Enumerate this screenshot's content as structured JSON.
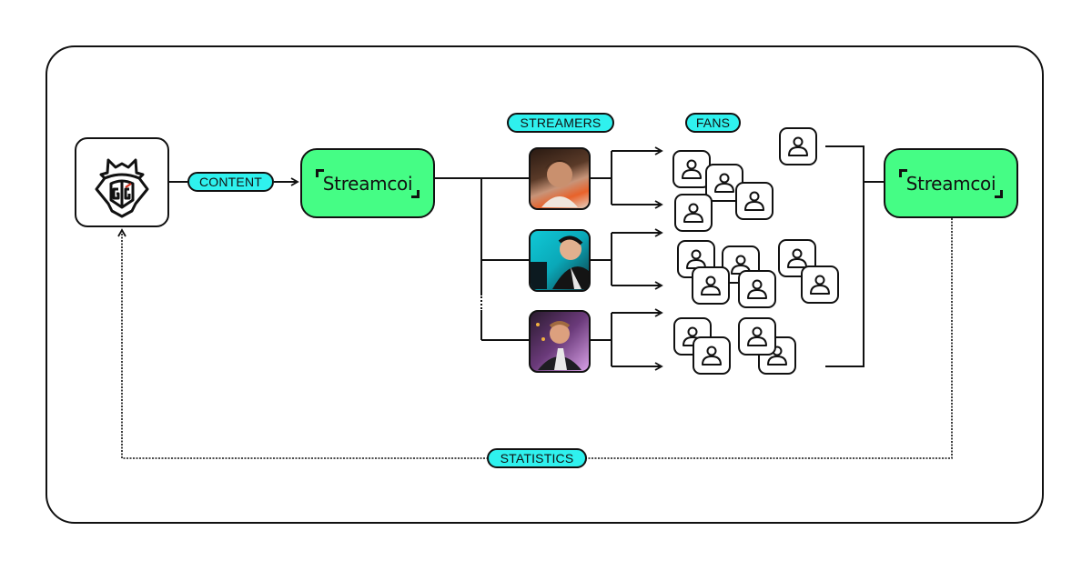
{
  "diagram": {
    "source": {
      "name": "G2 Esports",
      "icon": "g2-samurai-logo-icon"
    },
    "labels": {
      "content": "CONTENT",
      "streamers": "STREAMERS",
      "fans": "FANS",
      "statistics": "STATISTICS"
    },
    "platform": {
      "name": "Streamcoi"
    },
    "streamers": [
      {
        "id": "streamer-1",
        "fans_count": 4,
        "palette": [
          "#3a2418",
          "#e8622a",
          "#d9b8a0"
        ]
      },
      {
        "id": "streamer-2",
        "fans_count": 6,
        "palette": [
          "#10c8d6",
          "#1a1a1a",
          "#e6e6e6"
        ]
      },
      {
        "id": "streamer-3",
        "fans_count": 4,
        "palette": [
          "#2a1a2e",
          "#b86ad0",
          "#d89a7a"
        ]
      }
    ],
    "extra_fans": 1,
    "colors": {
      "pill": "#2ff1ee",
      "brand": "#45fd85",
      "stroke": "#111111",
      "accent_red": "#d8321e"
    }
  }
}
